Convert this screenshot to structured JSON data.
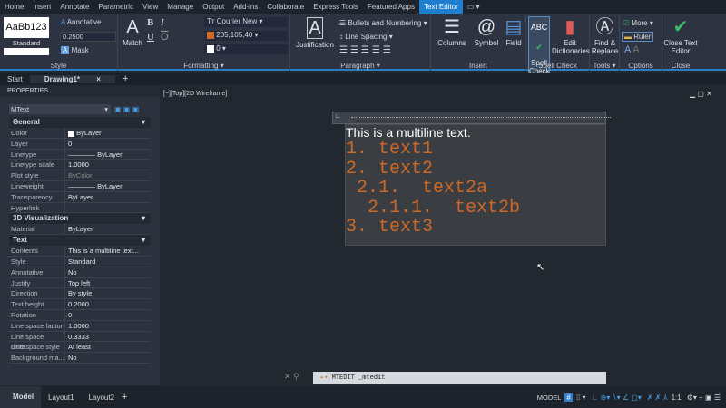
{
  "menu_tabs": [
    "Home",
    "Insert",
    "Annotate",
    "Parametric",
    "View",
    "Manage",
    "Output",
    "Add-ins",
    "Collaborate",
    "Express Tools",
    "Featured Apps",
    "Text Editor"
  ],
  "active_tab": "Text Editor",
  "ribbon": {
    "style": {
      "label": "Style",
      "preview": "AaBb123",
      "style_name": "Standard",
      "annotative": "Annotative",
      "height": "0.2500",
      "mask": "Mask"
    },
    "formatting": {
      "label": "Formatting",
      "match": "Match",
      "font": "Courier New",
      "color_value": "205,105,40",
      "color_hex": "#cd6928",
      "oblique": "0",
      "bold": "B",
      "italic": "I",
      "underline": "U",
      "overline": "O"
    },
    "paragraph": {
      "label": "Paragraph",
      "justification": "Justification",
      "bullets": "Bullets and Numbering",
      "line_spacing": "Line Spacing"
    },
    "insert": {
      "label": "Insert",
      "columns": "Columns",
      "symbol": "Symbol",
      "field": "Field"
    },
    "spell": {
      "label": "Spell Check",
      "spell_check": "Spell Check",
      "edit_dictionaries": "Edit Dictionaries"
    },
    "tools": {
      "label": "Tools",
      "find_replace": "Find & Replace"
    },
    "options": {
      "label": "Options",
      "more": "More",
      "ruler": "Ruler"
    },
    "close": {
      "label": "Close",
      "close_editor": "Close Text Editor"
    }
  },
  "doc_tabs": {
    "start": "Start",
    "drawing": "Drawing1*"
  },
  "viewport_label": "[−][Top][2D Wireframe]",
  "properties": {
    "title": "PROPERTIES",
    "selector": "MText",
    "sections": [
      {
        "name": "General",
        "rows": [
          [
            "Color",
            "ByLayer"
          ],
          [
            "Layer",
            "0"
          ],
          [
            "Linetype",
            "———— ByLayer"
          ],
          [
            "Linetype scale",
            "1.0000"
          ],
          [
            "Plot style",
            "ByColor"
          ],
          [
            "Lineweight",
            "———— ByLayer"
          ],
          [
            "Transparency",
            "ByLayer"
          ],
          [
            "Hyperlink",
            ""
          ]
        ]
      },
      {
        "name": "3D Visualization",
        "rows": [
          [
            "Material",
            "ByLayer"
          ]
        ]
      },
      {
        "name": "Text",
        "rows": [
          [
            "Contents",
            "This is a multiline text..."
          ],
          [
            "Style",
            "Standard"
          ],
          [
            "Annotative",
            "No"
          ],
          [
            "Justify",
            "Top left"
          ],
          [
            "Direction",
            "By style"
          ],
          [
            "Text height",
            "0.2000"
          ],
          [
            "Rotation",
            "0"
          ],
          [
            "Line space factor",
            "1.0000"
          ],
          [
            "Line space dista...",
            "0.3333"
          ],
          [
            "Line space style",
            "At least"
          ],
          [
            "Background ma...",
            "No"
          ]
        ]
      }
    ]
  },
  "mtext": {
    "heading": "This is a multiline text.",
    "lines": [
      "1. text1",
      "2. text2",
      " 2.1.  text2a",
      "  2.1.1.  text2b",
      "3. text3"
    ]
  },
  "command_line": "MTEDIT _mtedit",
  "layout_tabs": [
    "Model",
    "Layout1",
    "Layout2"
  ],
  "status": {
    "model": "MODEL",
    "scale": "1:1"
  }
}
